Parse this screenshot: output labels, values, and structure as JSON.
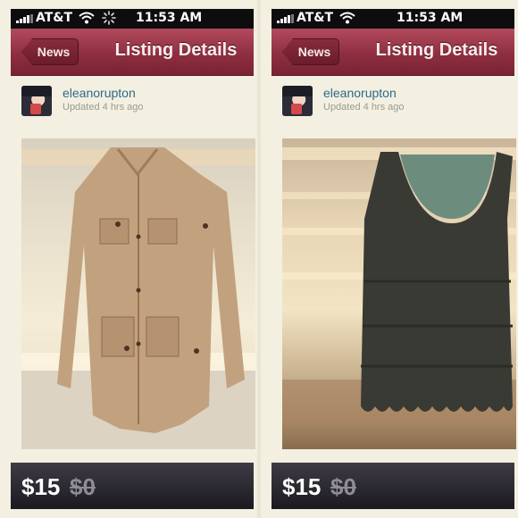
{
  "panels": [
    {
      "status": {
        "carrier": "AT&T",
        "time": "11:53 AM"
      },
      "nav": {
        "back_label": "News",
        "title": "Listing Details"
      },
      "user": {
        "name": "eleanorupton",
        "updated": "Updated 4 hrs ago"
      },
      "item": {
        "photo_subject": "tan-utility-jacket",
        "price": "$15",
        "original_price": "$0"
      }
    },
    {
      "status": {
        "carrier": "AT&T",
        "time": "11:53 AM"
      },
      "nav": {
        "back_label": "News",
        "title": "Listing Details"
      },
      "user": {
        "name": "eleanorupton",
        "updated": "Updated 4 hrs ago"
      },
      "item": {
        "photo_subject": "dark-lace-tank-top",
        "price": "$15",
        "original_price": "$0"
      }
    }
  ],
  "colors": {
    "navbar": "#8e2f41",
    "username": "#2f6a86",
    "price_bar": "#2a2730",
    "statusbar": "#0d0d0d"
  },
  "icons": [
    "signal-bars-icon",
    "wifi-icon",
    "activity-spinner-icon",
    "back-arrow-icon"
  ]
}
